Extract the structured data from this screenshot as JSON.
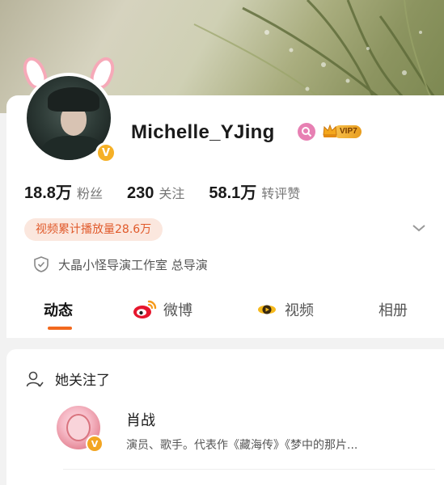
{
  "profile": {
    "username": "Michelle_YJing",
    "vip_label": "VIP7",
    "verified_mark": "V",
    "stats": [
      {
        "value": "18.8万",
        "label": "粉丝"
      },
      {
        "value": "230",
        "label": "关注"
      },
      {
        "value": "58.1万",
        "label": "转评赞"
      }
    ],
    "video_plays": "视频累计播放量28.6万",
    "organization": "大晶小怪导演工作室 总导演"
  },
  "tabs": [
    {
      "label": "动态",
      "icon": "none"
    },
    {
      "label": "微博",
      "icon": "weibo-icon"
    },
    {
      "label": "视频",
      "icon": "video-icon"
    },
    {
      "label": "相册",
      "icon": "none"
    }
  ],
  "following": {
    "header": "她关注了",
    "items": [
      {
        "name": "肖战",
        "desc": "演员、歌手。代表作《藏海传》《梦中的那片...",
        "badge": "V"
      }
    ]
  },
  "colors": {
    "accent": "#f2691e",
    "pill_bg": "#fbe7de",
    "pill_text": "#e05a2b",
    "verify": "#f5b026",
    "gender": "#e780b3"
  }
}
